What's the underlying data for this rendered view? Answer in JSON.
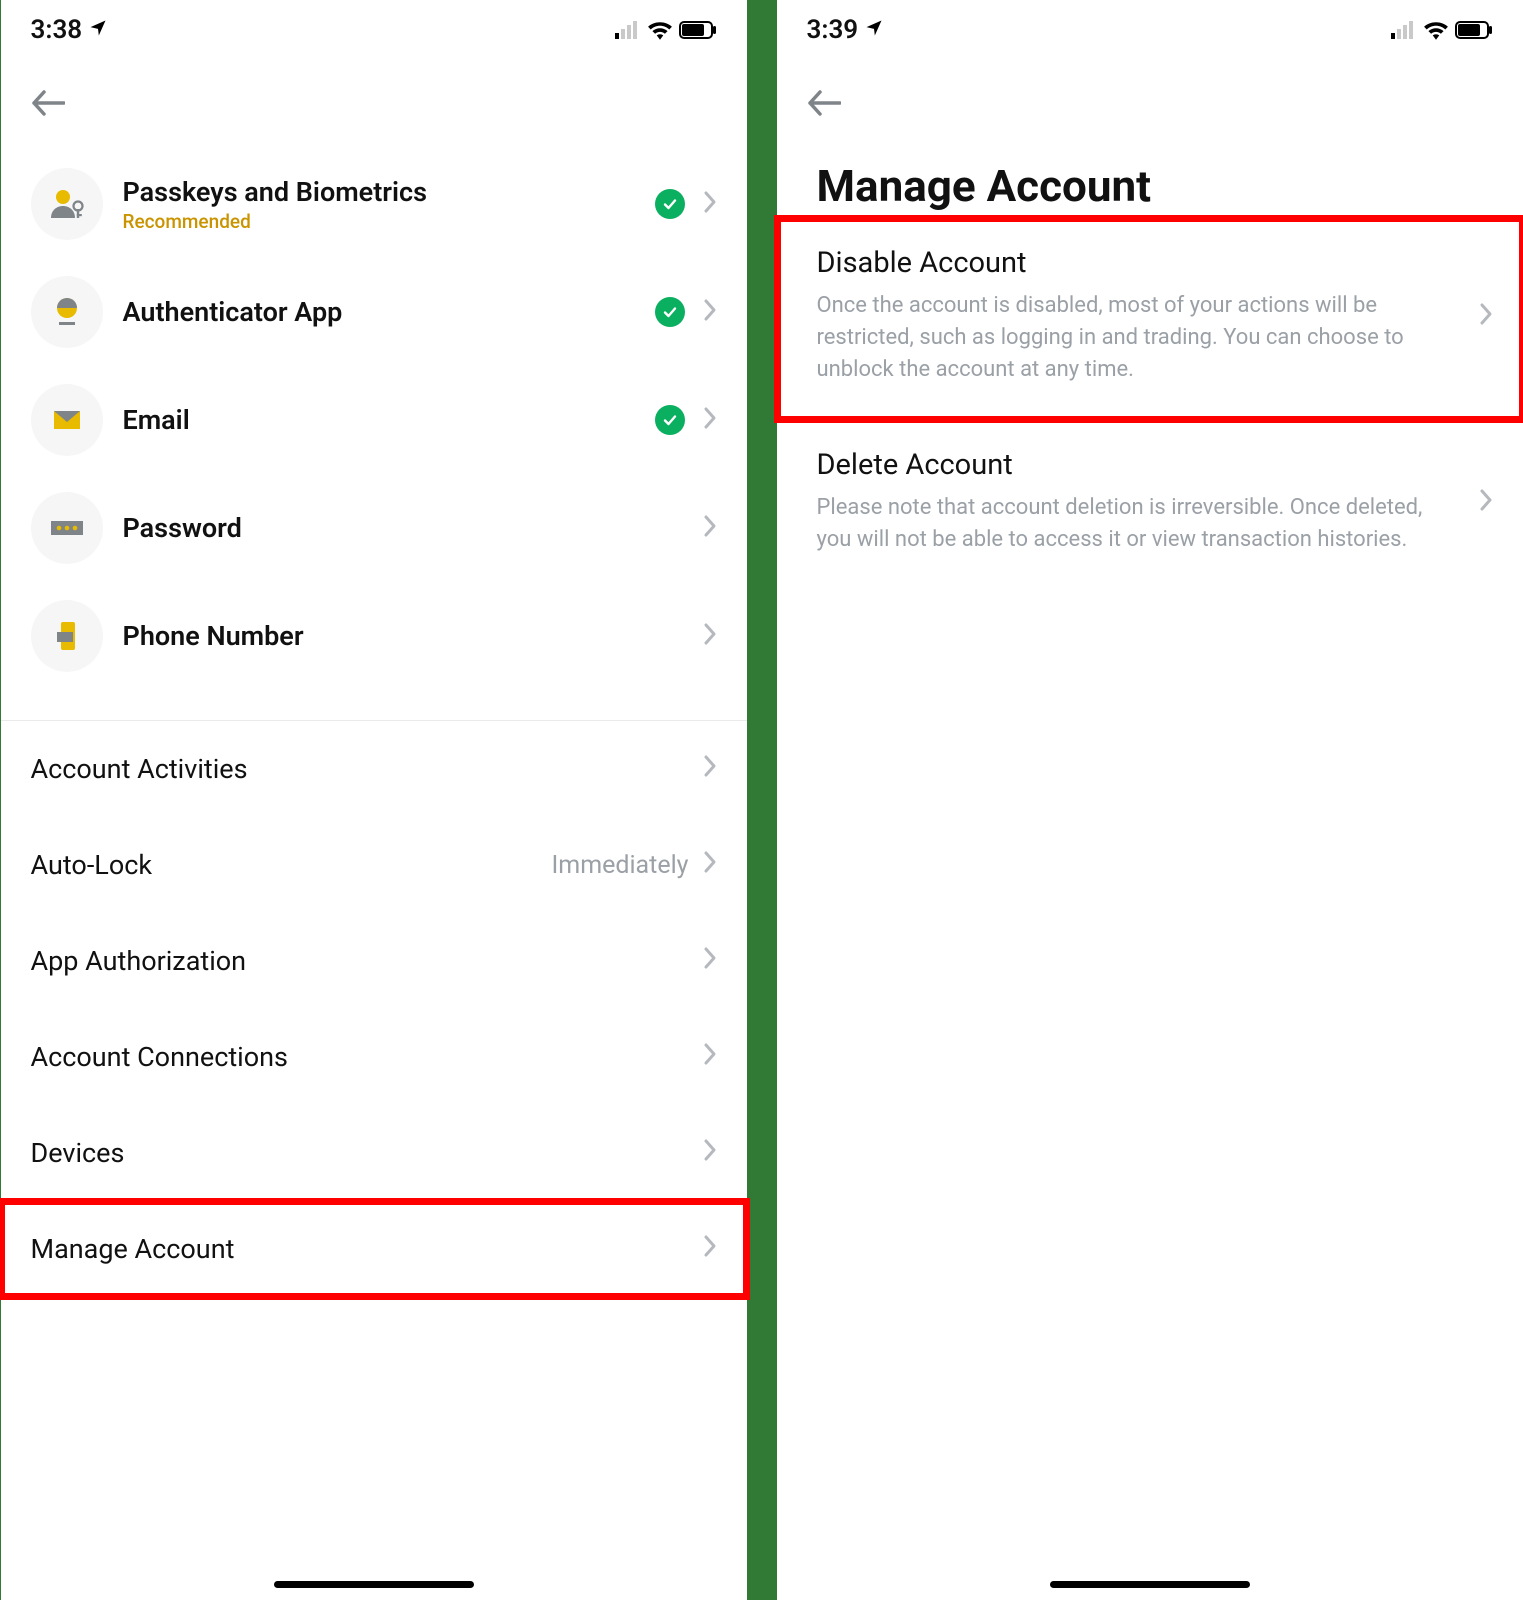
{
  "left": {
    "status_time": "3:38",
    "auth_items": [
      {
        "label": "Passkeys and Biometrics",
        "sub": "Recommended",
        "checked": true
      },
      {
        "label": "Authenticator App",
        "sub": "",
        "checked": true
      },
      {
        "label": "Email",
        "sub": "",
        "checked": true
      },
      {
        "label": "Password",
        "sub": "",
        "checked": false
      },
      {
        "label": "Phone Number",
        "sub": "",
        "checked": false
      }
    ],
    "plain_items": [
      {
        "label": "Account Activities",
        "value": "",
        "highlight": false
      },
      {
        "label": "Auto-Lock",
        "value": "Immediately",
        "highlight": false
      },
      {
        "label": "App Authorization",
        "value": "",
        "highlight": false
      },
      {
        "label": "Account Connections",
        "value": "",
        "highlight": false
      },
      {
        "label": "Devices",
        "value": "",
        "highlight": false
      },
      {
        "label": "Manage Account",
        "value": "",
        "highlight": true
      }
    ]
  },
  "right": {
    "status_time": "3:39",
    "page_title": "Manage Account",
    "cards": [
      {
        "title": "Disable Account",
        "desc": "Once the account is disabled, most of your actions will be restricted, such as logging in and trading. You can choose to unblock the account at any time.",
        "highlight": true
      },
      {
        "title": "Delete Account",
        "desc": "Please note that account deletion is irreversible. Once deleted, you will not be able to access it or view transaction histories.",
        "highlight": false
      }
    ]
  }
}
